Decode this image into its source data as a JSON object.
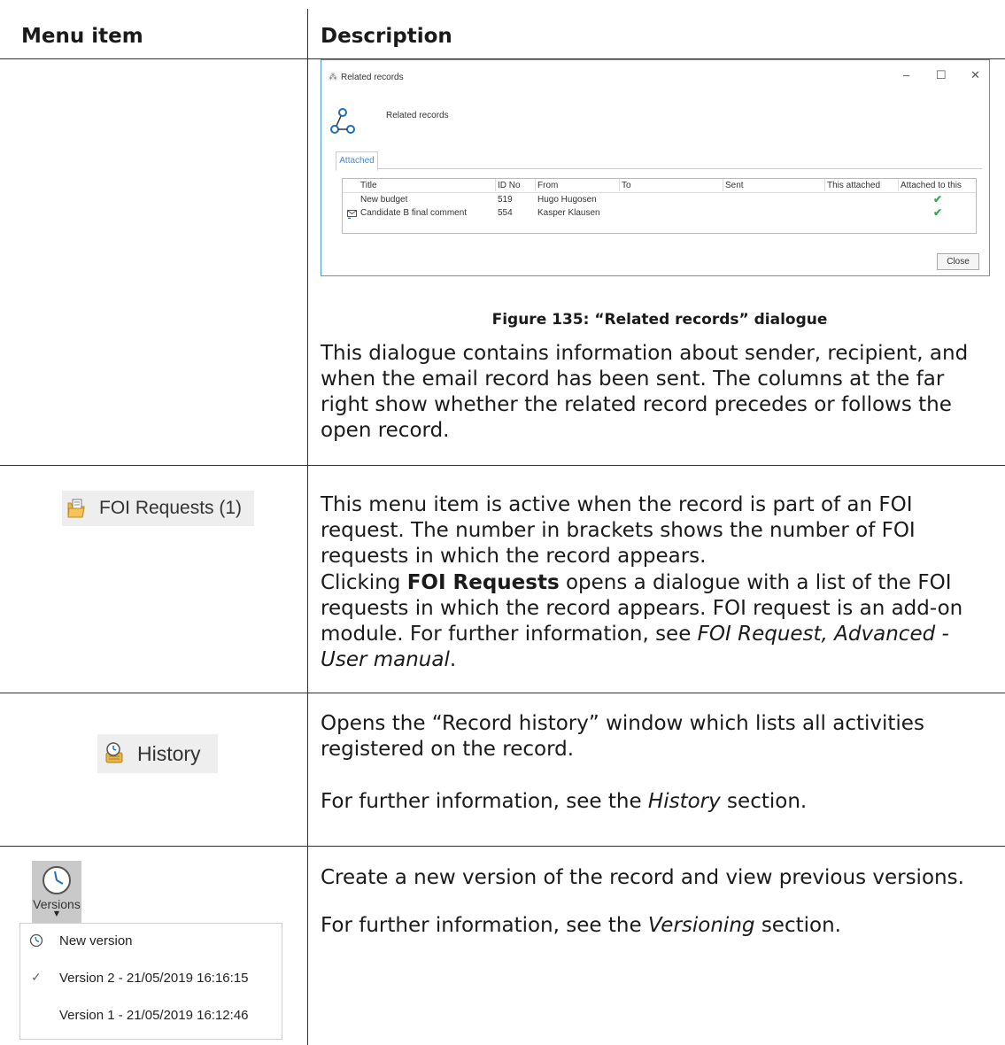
{
  "table": {
    "col_menu": "Menu item",
    "col_desc": "Description"
  },
  "dialog": {
    "window_title": "Related records",
    "header_title": "Related records",
    "tab": "Attached",
    "columns": [
      "Title",
      "ID No",
      "From",
      "To",
      "Sent",
      "This attached",
      "Attached to this"
    ],
    "rows": [
      {
        "title": "New budget",
        "id": "519",
        "from": "Hugo Hugosen",
        "to": "",
        "sent": "",
        "icon": ""
      },
      {
        "title": "Candidate B final comment",
        "id": "554",
        "from": "Kasper Klausen",
        "to": "",
        "sent": "",
        "icon": "email-icon"
      }
    ],
    "close_label": "Close",
    "check_glyph": "✔"
  },
  "caption": "Figure 135: “Related records” dialogue",
  "related_desc": "This dialogue contains information about sender, recipient, and when the email record has been sent. The columns at the far right show whether the related record precedes or follows the open record.",
  "foi": {
    "button_label": "FOI Requests (1)",
    "p1": "This menu item is active when the record is part of an FOI request. The number in brackets shows the number of FOI requests in which the record appears.",
    "p2_pre": "Clicking ",
    "p2_bold": "FOI Requests",
    "p2_mid": " opens a dialogue with a list of the FOI requests in which the record appears. FOI request is an add-on module. For further information, see ",
    "p2_italic": "FOI Request, Advanced - User manual",
    "p2_post": "."
  },
  "history": {
    "button_label": "History",
    "p1": "Opens the “Record history” window which lists all activities registered on the record.",
    "p2_pre": "For further information, see the ",
    "p2_italic": "History",
    "p2_post": " section."
  },
  "versions": {
    "button_label": "Versions",
    "menu": {
      "new_version": "New version",
      "v2": "Version 2 - 21/05/2019 16:16:15",
      "v1": "Version 1 - 21/05/2019 16:12:46"
    },
    "p1": "Create a new version of the record and view previous versions.",
    "p2_pre": "For further information, see the ",
    "p2_italic": "Versioning",
    "p2_post": " section."
  }
}
